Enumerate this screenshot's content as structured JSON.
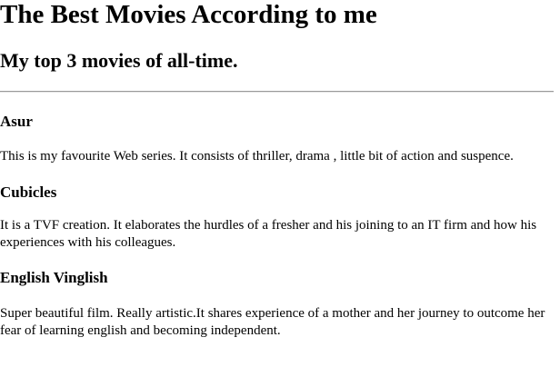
{
  "header": {
    "title": "The Best Movies According to me",
    "subtitle": "My top 3 movies of all-time."
  },
  "movies": [
    {
      "title": "Asur",
      "description": "This is my favourite Web series. It consists of thriller, drama , little bit of action and suspence."
    },
    {
      "title": "Cubicles",
      "description": "It is a TVF creation. It elaborates the hurdles of a fresher and his joining to an IT firm and how his experiences with his colleagues."
    },
    {
      "title": "English Vinglish",
      "description": "Super beautiful film. Really artistic.It shares experience of a mother and her journey to outcome her fear of learning english and becoming independent."
    }
  ]
}
